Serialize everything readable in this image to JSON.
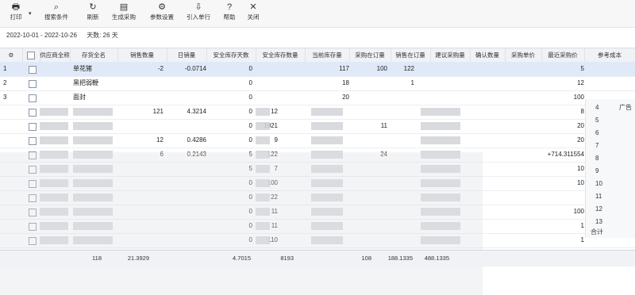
{
  "toolbar": {
    "buttons": [
      {
        "label": "打印",
        "icon": "printer-icon",
        "glyph": "🖶"
      },
      {
        "label": "搜索条件",
        "icon": "filter-icon",
        "glyph": "⌕"
      },
      {
        "label": "刷新",
        "icon": "refresh-icon",
        "glyph": "↻"
      },
      {
        "label": "生成采购",
        "icon": "document-icon",
        "glyph": "▤"
      },
      {
        "label": "参数设置",
        "icon": "settings-icon",
        "glyph": "⚙"
      },
      {
        "label": "引入单行",
        "icon": "import-icon",
        "glyph": "⇩"
      },
      {
        "label": "帮助",
        "icon": "help-icon",
        "glyph": "?"
      },
      {
        "label": "关闭",
        "icon": "close-icon",
        "glyph": "✕"
      }
    ],
    "dropdown_glyph": "▾"
  },
  "date_range": {
    "text": "2022-10-01 - 2022-10-26",
    "days_label": "天数: 26 天"
  },
  "columns": [
    "",
    "",
    "供应商全称",
    "存货全名",
    "销售数量",
    "日销量",
    "安全库存天数",
    "安全库存数量",
    "当前库存量",
    "采购在订量",
    "销售在订量",
    "建议采购量",
    "确认数量",
    "采购单价",
    "最近采购价",
    "参考成本"
  ],
  "rows": [
    {
      "idx": "1",
      "name": "单花猪",
      "qty": "-2",
      "daily": "-0.0714",
      "safe_days": "0",
      "safe_qty": "",
      "stock": "117",
      "po": "100",
      "so": "122",
      "cost": "5"
    },
    {
      "idx": "2",
      "name": "黑把弱鞭",
      "qty": "",
      "daily": "",
      "safe_days": "0",
      "safe_qty": "",
      "stock": "18",
      "po": "",
      "so": "1",
      "cost": "12"
    },
    {
      "idx": "3",
      "name": "面封",
      "qty": "",
      "daily": "",
      "safe_days": "0",
      "safe_qty": "",
      "stock": "20",
      "po": "",
      "so": "",
      "cost": "100"
    },
    {
      "idx": "",
      "name": "",
      "qty": "121",
      "daily": "4.3214",
      "safe_days": "0",
      "safe_qty": "12",
      "stock": "",
      "po": "",
      "so": "",
      "cost": "8"
    },
    {
      "idx": "",
      "name": "",
      "qty": "",
      "daily": "",
      "safe_days": "0",
      "safe_qty": "1021",
      "stock": "",
      "po": "11",
      "so": "",
      "cost": "20"
    },
    {
      "idx": "",
      "name": "",
      "qty": "12",
      "daily": "0.4286",
      "safe_days": "0",
      "safe_qty": "9",
      "stock": "",
      "po": "",
      "so": "",
      "cost": "20"
    },
    {
      "idx": "",
      "name": "",
      "qty": "6",
      "daily": "0.2143",
      "safe_days": "5",
      "safe_qty": "122",
      "stock": "",
      "po": "24",
      "so": "",
      "cost": "+714.311554"
    },
    {
      "idx": "",
      "name": "",
      "qty": "",
      "daily": "",
      "safe_days": "5",
      "safe_qty": "7",
      "stock": "",
      "po": "",
      "so": "",
      "cost": "10"
    },
    {
      "idx": "",
      "name": "",
      "qty": "",
      "daily": "",
      "safe_days": "0",
      "safe_qty": "100",
      "stock": "",
      "po": "",
      "so": "",
      "cost": "10"
    },
    {
      "idx": "",
      "name": "",
      "qty": "",
      "daily": "",
      "safe_days": "0",
      "safe_qty": "22",
      "stock": "",
      "po": "",
      "so": "",
      "cost": ""
    },
    {
      "idx": "",
      "name": "",
      "qty": "",
      "daily": "",
      "safe_days": "0",
      "safe_qty": "11",
      "stock": "",
      "po": "",
      "so": "",
      "cost": "100"
    },
    {
      "idx": "",
      "name": "",
      "qty": "",
      "daily": "",
      "safe_days": "0",
      "safe_qty": "11",
      "stock": "",
      "po": "",
      "so": "",
      "cost": "1"
    },
    {
      "idx": "",
      "name": "",
      "qty": "",
      "daily": "",
      "safe_days": "0",
      "safe_qty": "110",
      "stock": "",
      "po": "",
      "so": "",
      "cost": "1"
    }
  ],
  "side_panel": {
    "numbers": [
      "4",
      "5",
      "6",
      "7",
      "8",
      "9",
      "10",
      "11",
      "12",
      "13"
    ],
    "label": "广告",
    "footer": "合计"
  },
  "footer_totals": {
    "qty": "118",
    "daily": "21.3929",
    "safe_days": "4.7015",
    "safe_qty": "8193",
    "po": "108",
    "so": "188.1335",
    "extra": "488.1335"
  }
}
